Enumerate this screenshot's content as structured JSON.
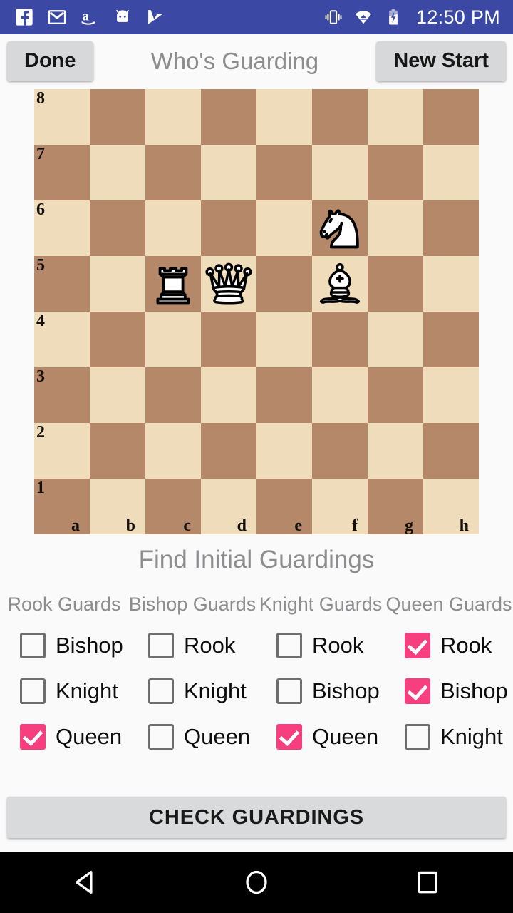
{
  "status_bar": {
    "background": "#3b49a4",
    "left_icons": [
      {
        "name": "facebook-icon",
        "label": "Facebook"
      },
      {
        "name": "gmail-icon",
        "label": "Gmail"
      },
      {
        "name": "amazon-icon",
        "label": "Amazon"
      },
      {
        "name": "android-robot-icon",
        "label": "Android"
      },
      {
        "name": "checkmark-flag-icon",
        "label": "Tasks"
      }
    ],
    "right_icons": [
      {
        "name": "vibrate-icon",
        "label": "Vibrate"
      },
      {
        "name": "wifi-icon",
        "label": "Wi-Fi"
      },
      {
        "name": "battery-charging-icon",
        "label": "Battery charging"
      }
    ],
    "time": "12:50 PM"
  },
  "appbar": {
    "done_label": "Done",
    "title": "Who's Guarding",
    "new_start_label": "New Start"
  },
  "board": {
    "light_color": "#efdcba",
    "dark_color": "#b5886a",
    "ranks": [
      "8",
      "7",
      "6",
      "5",
      "4",
      "3",
      "2",
      "1"
    ],
    "files": [
      "a",
      "b",
      "c",
      "d",
      "e",
      "f",
      "g",
      "h"
    ],
    "pieces": [
      {
        "square": "f6",
        "piece": "white-knight",
        "file_index": 5,
        "rank_index": 2
      },
      {
        "square": "c5",
        "piece": "white-rook",
        "file_index": 2,
        "rank_index": 3
      },
      {
        "square": "d5",
        "piece": "white-queen",
        "file_index": 3,
        "rank_index": 3
      },
      {
        "square": "f5",
        "piece": "white-bishop",
        "file_index": 5,
        "rank_index": 3
      }
    ]
  },
  "section_title": "Find Initial Guardings",
  "accent_color": "#f73f80",
  "columns": [
    {
      "header": "Rook Guards",
      "options": [
        {
          "label": "Bishop",
          "checked": false
        },
        {
          "label": "Knight",
          "checked": false
        },
        {
          "label": "Queen",
          "checked": true
        }
      ]
    },
    {
      "header": "Bishop Guards",
      "options": [
        {
          "label": "Rook",
          "checked": false
        },
        {
          "label": "Knight",
          "checked": false
        },
        {
          "label": "Queen",
          "checked": false
        }
      ]
    },
    {
      "header": "Knight Guards",
      "options": [
        {
          "label": "Rook",
          "checked": false
        },
        {
          "label": "Bishop",
          "checked": false
        },
        {
          "label": "Queen",
          "checked": true
        }
      ]
    },
    {
      "header": "Queen Guards",
      "options": [
        {
          "label": "Rook",
          "checked": true
        },
        {
          "label": "Bishop",
          "checked": true
        },
        {
          "label": "Knight",
          "checked": false
        }
      ]
    }
  ],
  "check_button_label": "CHECK GUARDINGS",
  "nav_bar": {
    "back_label": "Back",
    "home_label": "Home",
    "recents_label": "Recent apps"
  }
}
